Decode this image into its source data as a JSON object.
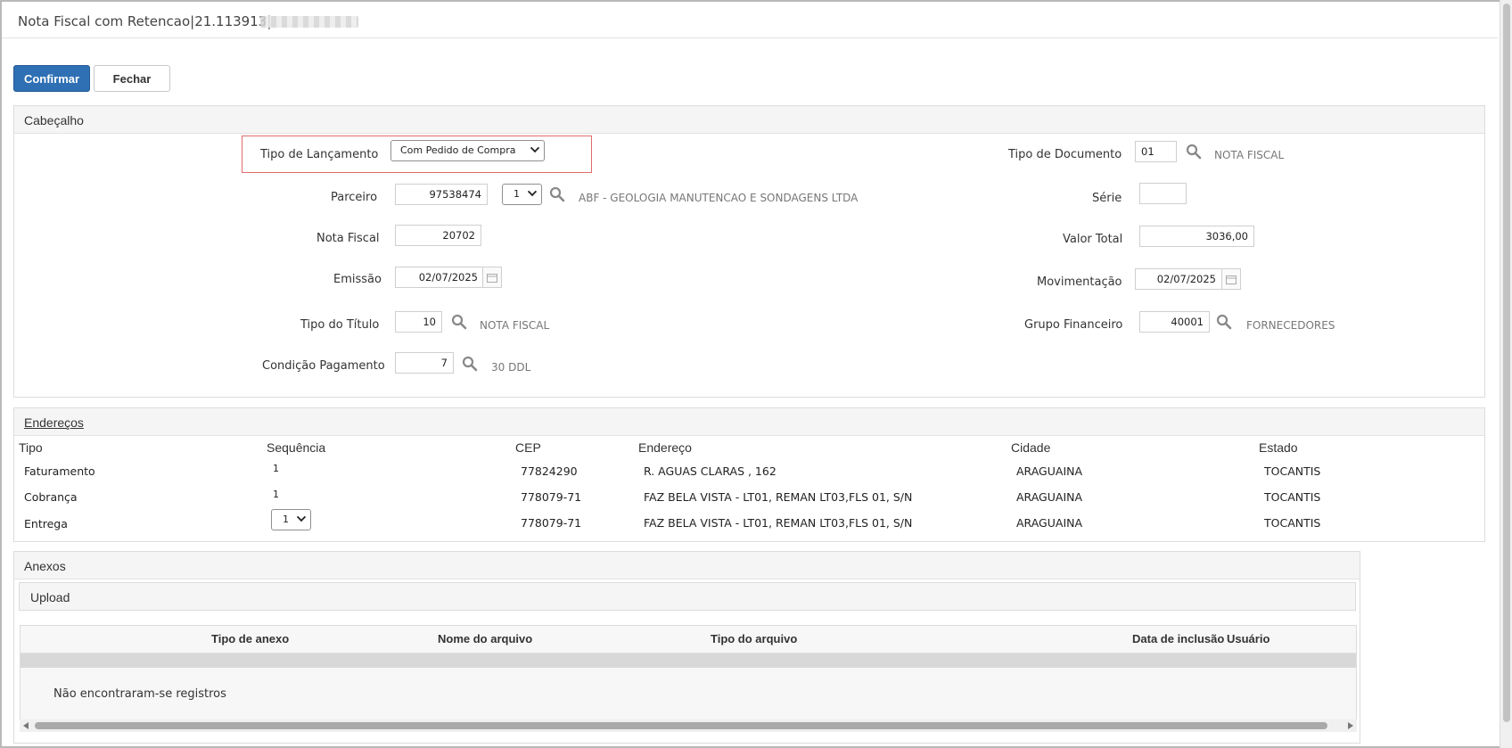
{
  "window": {
    "title": "Nota Fiscal com Retencao|21.113913|"
  },
  "toolbar": {
    "confirm_label": "Confirmar",
    "close_label": "Fechar"
  },
  "header_section": {
    "title": "Cabeçalho",
    "tipo_lancamento": {
      "label": "Tipo de Lançamento",
      "value": "Com Pedido de Compra"
    },
    "tipo_documento": {
      "label": "Tipo de Documento",
      "value": "01",
      "desc": "NOTA FISCAL"
    },
    "parceiro": {
      "label": "Parceiro",
      "value": "97538474",
      "seq": "1",
      "desc": "ABF - GEOLOGIA MANUTENCAO E SONDAGENS LTDA"
    },
    "serie": {
      "label": "Série",
      "value": ""
    },
    "nota_fiscal": {
      "label": "Nota Fiscal",
      "value": "20702"
    },
    "valor_total": {
      "label": "Valor Total",
      "value": "3036,00"
    },
    "emissao": {
      "label": "Emissão",
      "value": "02/07/2025"
    },
    "movimentacao": {
      "label": "Movimentação",
      "value": "02/07/2025"
    },
    "tipo_titulo": {
      "label": "Tipo do Título",
      "value": "10",
      "desc": "NOTA FISCAL"
    },
    "grupo_financeiro": {
      "label": "Grupo Financeiro",
      "value": "40001",
      "desc": "FORNECEDORES"
    },
    "condicao_pagamento": {
      "label": "Condição Pagamento",
      "value": "7",
      "desc": "30 DDL"
    }
  },
  "addresses": {
    "title": "Endereços",
    "columns": [
      "Tipo",
      "Sequência",
      "CEP",
      "Endereço",
      "Cidade",
      "Estado"
    ],
    "rows": [
      {
        "tipo": "Faturamento",
        "seq": "1",
        "cep": "77824290",
        "endereco": "R. AGUAS CLARAS , 162",
        "cidade": "ARAGUAINA",
        "estado": "TOCANTIS"
      },
      {
        "tipo": "Cobrança",
        "seq": "1",
        "cep": "778079-71",
        "endereco": "FAZ BELA VISTA - LT01, REMAN LT03,FLS 01, S/N",
        "cidade": "ARAGUAINA",
        "estado": "TOCANTIS"
      },
      {
        "tipo": "Entrega",
        "seq": "1",
        "cep": "778079-71",
        "endereco": "FAZ BELA VISTA - LT01, REMAN LT03,FLS 01, S/N",
        "cidade": "ARAGUAINA",
        "estado": "TOCANTIS"
      }
    ]
  },
  "attachments": {
    "title": "Anexos",
    "upload_label": "Upload",
    "columns": [
      "Tipo de anexo",
      "Nome do arquivo",
      "Tipo do arquivo",
      "Data de inclusão",
      "Usuário"
    ],
    "empty_message": "Não encontraram-se registros"
  },
  "colors": {
    "primary": "#2f70b4",
    "highlight": "#e06c6c",
    "panel_head": "#f5f5f5"
  }
}
